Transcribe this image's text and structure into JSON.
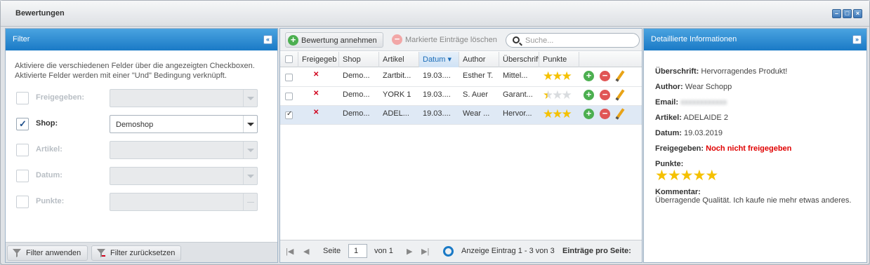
{
  "window": {
    "title": "Bewertungen"
  },
  "filter": {
    "title": "Filter",
    "description_line1": "Aktiviere die verschiedenen Felder über die angezeigten Checkboxen.",
    "description_line2": "Aktivierte Felder werden mit einer \"Und\" Bedingung verknüpft.",
    "fields": [
      {
        "label": "Freigegeben:",
        "checked": false,
        "value": ""
      },
      {
        "label": "Shop:",
        "checked": true,
        "value": "Demoshop"
      },
      {
        "label": "Artikel:",
        "checked": false,
        "value": ""
      },
      {
        "label": "Datum:",
        "checked": false,
        "value": ""
      },
      {
        "label": "Punkte:",
        "checked": false,
        "value": ""
      }
    ],
    "apply_label": "Filter anwenden",
    "reset_label": "Filter zurücksetzen"
  },
  "grid": {
    "accept_label": "Bewertung annehmen",
    "delete_label": "Markierte Einträge löschen",
    "search_placeholder": "Suche...",
    "columns": [
      "Freigegeb",
      "Shop",
      "Artikel",
      "Datum",
      "Author",
      "Überschrift",
      "Punkte"
    ],
    "rows": [
      {
        "shop": "Demo...",
        "artikel": "Zartbit...",
        "datum": "19.03....",
        "author": "Esther T.",
        "ueberschrift": "Mittel...",
        "stars": 3,
        "selected": false
      },
      {
        "shop": "Demo...",
        "artikel": "YORK 1",
        "datum": "19.03....",
        "author": "S. Auer",
        "ueberschrift": "Garant...",
        "stars": 0.5,
        "selected": false
      },
      {
        "shop": "Demo...",
        "artikel": "ADEL...",
        "datum": "19.03....",
        "author": "Wear ...",
        "ueberschrift": "Hervor...",
        "stars": 3,
        "selected": true
      }
    ],
    "paging": {
      "page_label": "Seite",
      "page_value": "1",
      "of_label": "von 1",
      "info": "Anzeige Eintrag 1 - 3 von 3",
      "per_page_label": "Einträge pro Seite:"
    }
  },
  "detail": {
    "title": "Detaillierte Informationen",
    "headline_label": "Überschrift:",
    "headline_value": "Hervorragendes Produkt!",
    "author_label": "Author:",
    "author_value": "Wear Schopp",
    "email_label": "Email:",
    "email_value": "",
    "article_label": "Artikel:",
    "article_value": "ADELAIDE 2",
    "date_label": "Datum:",
    "date_value": "19.03.2019",
    "released_label": "Freigegeben:",
    "released_value": "Noch nicht freigegeben",
    "points_label": "Punkte:",
    "points_value": 5,
    "comment_label": "Kommentar:",
    "comment_value": "Überragende Qualität. Ich kaufe nie mehr etwas anderes."
  },
  "colors": {
    "header": "#1a7ac6",
    "star": "#f5c100",
    "accept": "#4caf50",
    "delete": "#e05555",
    "not_released": "#e00000"
  }
}
